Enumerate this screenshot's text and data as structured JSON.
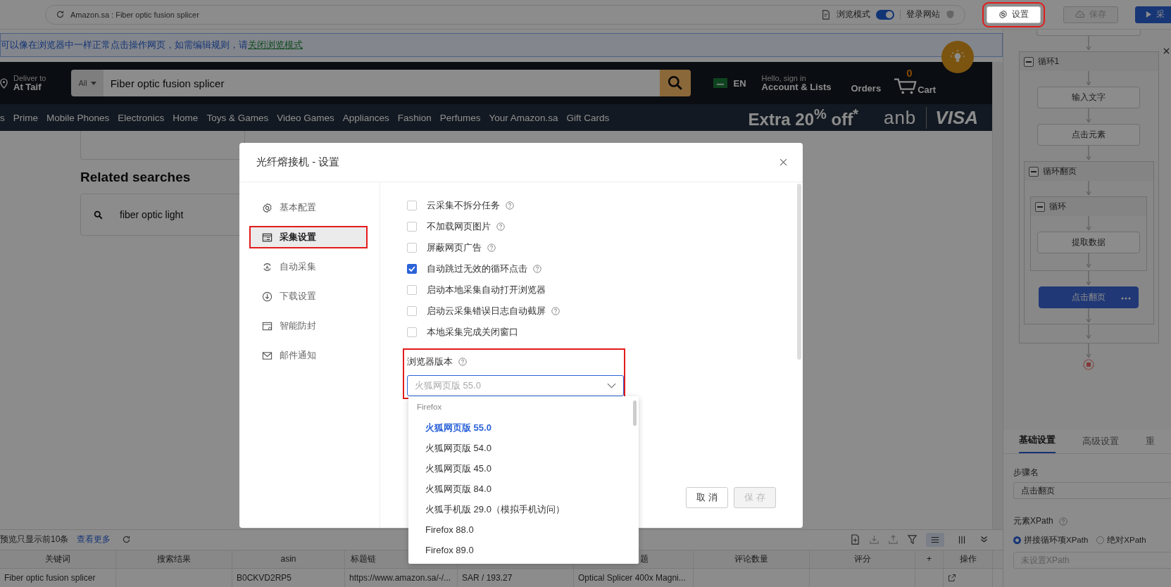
{
  "top_bar": {
    "address": "Amazon.sa : Fiber optic fusion splicer",
    "browse_mode": {
      "label": "浏览模式",
      "on": true
    },
    "login_site": "登录网站",
    "buttons": [
      {
        "label": "设置",
        "kind": "settings",
        "disabled": false,
        "highlighted": true
      },
      {
        "label": "保存",
        "kind": "save",
        "disabled": true,
        "highlighted": false
      },
      {
        "label": "采",
        "kind": "run",
        "disabled": false,
        "highlighted": false
      }
    ]
  },
  "notice": {
    "text": "可以像在浏览器中一样正常点击操作网页，如需编辑规则，请",
    "link": "关闭浏览模式"
  },
  "amazon": {
    "deliver_line1": "Deliver to",
    "deliver_line2": "At Taif",
    "search_category": "All",
    "search_value": "Fiber optic fusion splicer",
    "language": "EN",
    "account_line1": "Hello, sign in",
    "account_line2": "Account & Lists",
    "orders": "Orders",
    "cart_count": "0",
    "cart": "Cart",
    "nav": [
      "s",
      "Prime",
      "Mobile Phones",
      "Electronics",
      "Home",
      "Toys & Games",
      "Video Games",
      "Appliances",
      "Fashion",
      "Perfumes",
      "Your Amazon.sa",
      "Gift Cards"
    ],
    "promo": "Extra 20$^{%}$ off$^{*}$",
    "bank": "anb",
    "card": "VISA",
    "related_title": "Related searches",
    "related": [
      "fiber optic light"
    ]
  },
  "preview": {
    "note": "预览只显示前10条",
    "more": "查看更多",
    "view_modes": [
      {
        "selected": true
      },
      {
        "selected": false
      }
    ],
    "columns": [
      "关键词",
      "搜索结果",
      "asin",
      "标题链",
      "",
      "题",
      "评论数量",
      "评分",
      "+",
      "操作"
    ],
    "rows": [
      [
        "Fiber optic fusion splicer",
        "",
        "B0CKVD2RP5",
        "https://www.amazon.sa/-/...",
        "SAR / 193.27",
        "Optical Splicer 400x Magni...",
        "",
        "",
        "",
        ""
      ]
    ]
  },
  "flow": {
    "loop1": "循环1",
    "input_text": "输入文字",
    "click_element": "点击元素",
    "page_loop": "循环翻页",
    "loop": "循环",
    "extract": "提取数据",
    "click_page": "点击翻页"
  },
  "step_panel": {
    "tabs": [
      {
        "label": "基础设置",
        "selected": true
      },
      {
        "label": "高级设置",
        "selected": false
      },
      {
        "label": "重",
        "selected": false
      }
    ],
    "name_label": "步骤名",
    "name_value": "点击翻页",
    "xpath_label": "元素XPath",
    "xpath_modes": [
      {
        "label": "拼接循环项XPath",
        "selected": true
      },
      {
        "label": "绝对XPath",
        "selected": false
      }
    ],
    "xpath_placeholder": "未设置XPath"
  },
  "dialog": {
    "title": "光纤熔接机 - 设置",
    "menu": [
      {
        "label": "基本配置",
        "selected": false,
        "highlighted": false
      },
      {
        "label": "采集设置",
        "selected": true,
        "highlighted": true
      },
      {
        "label": "自动采集",
        "selected": false,
        "highlighted": false
      },
      {
        "label": "下载设置",
        "selected": false,
        "highlighted": false
      },
      {
        "label": "智能防封",
        "selected": false,
        "highlighted": false
      },
      {
        "label": "邮件通知",
        "selected": false,
        "highlighted": false
      }
    ],
    "options": [
      {
        "label": "云采集不拆分任务",
        "checked": false,
        "help": true
      },
      {
        "label": "不加载网页图片",
        "checked": false,
        "help": true
      },
      {
        "label": "屏蔽网页广告",
        "checked": false,
        "help": true
      },
      {
        "label": "自动跳过无效的循环点击",
        "checked": true,
        "help": true
      },
      {
        "label": "启动本地采集自动打开浏览器",
        "checked": false,
        "help": false
      },
      {
        "label": "启动云采集错误日志自动截屏",
        "checked": false,
        "help": true
      },
      {
        "label": "本地采集完成关闭窗口",
        "checked": false,
        "help": false
      }
    ],
    "browser_version": {
      "label": "浏览器版本",
      "value": "火狐网页版 55.0",
      "highlighted": true,
      "group": "Firefox",
      "options": [
        {
          "label": "火狐网页版 55.0",
          "selected": true
        },
        {
          "label": "火狐网页版 54.0",
          "selected": false
        },
        {
          "label": "火狐网页版 45.0",
          "selected": false
        },
        {
          "label": "火狐网页版 84.0",
          "selected": false
        },
        {
          "label": "火狐手机版 29.0（模拟手机访问）",
          "selected": false
        },
        {
          "label": "Firefox 88.0",
          "selected": false
        },
        {
          "label": "Firefox 89.0",
          "selected": false
        }
      ]
    },
    "buttons": [
      {
        "label": "取 消",
        "disabled": false
      },
      {
        "label": "保 存",
        "disabled": true
      }
    ]
  }
}
